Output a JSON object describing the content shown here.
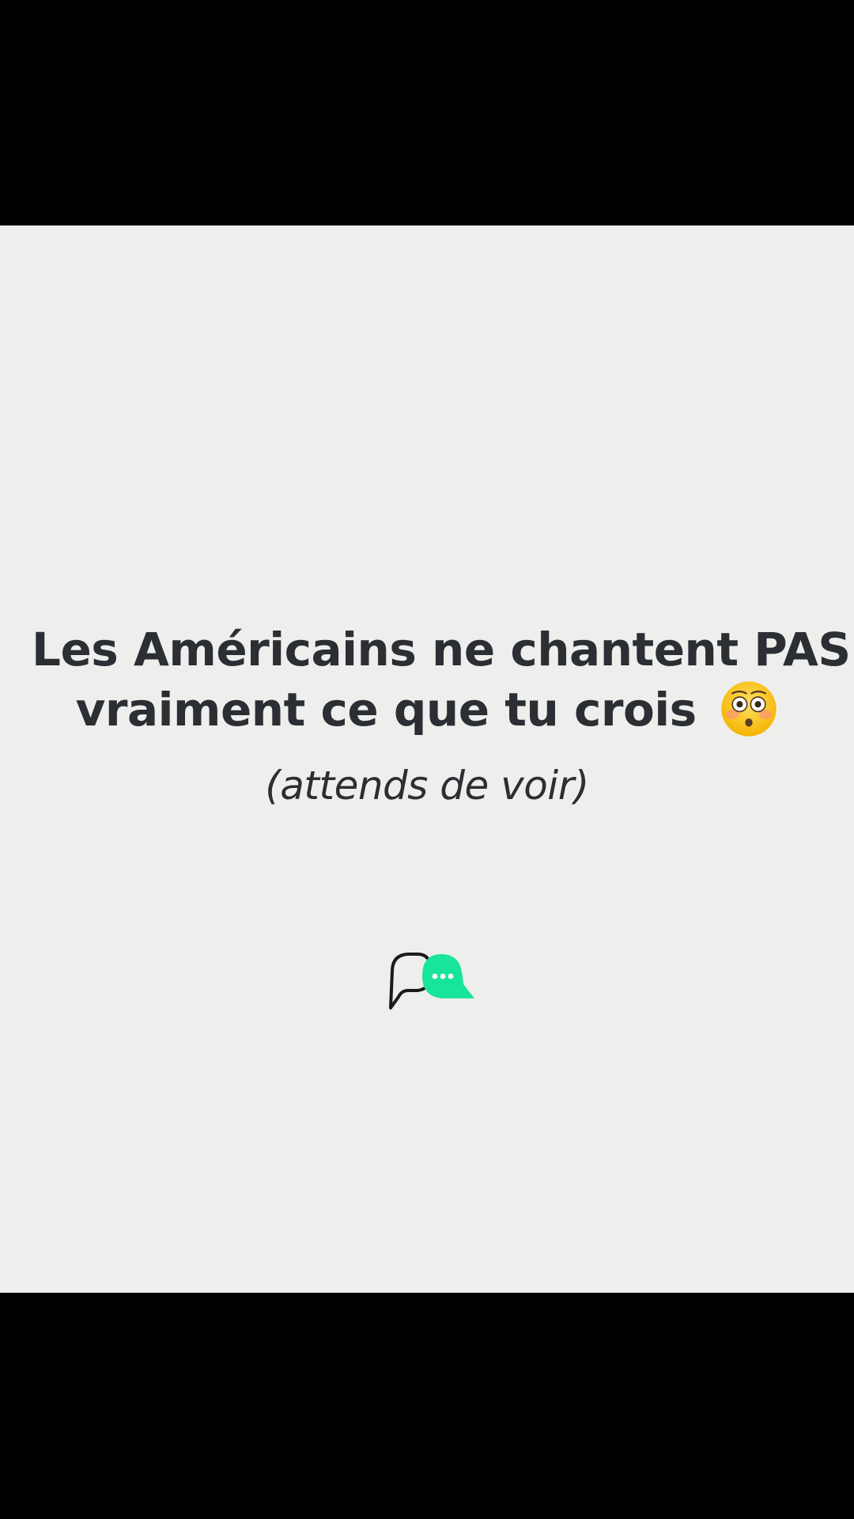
{
  "post": {
    "headline_line1": "Les Américains ne chantent PAS",
    "headline_line2": "vraiment ce que tu crois",
    "emoji": "flushed-face",
    "subtitle": "(attends de voir)"
  },
  "logo": {
    "icon": "chat-bubbles-icon",
    "accent_color": "#19e59a",
    "outline_color": "#1a1a1a"
  },
  "colors": {
    "background": "#eeeeed",
    "text": "#2b2e33",
    "letterbox": "#000000"
  }
}
